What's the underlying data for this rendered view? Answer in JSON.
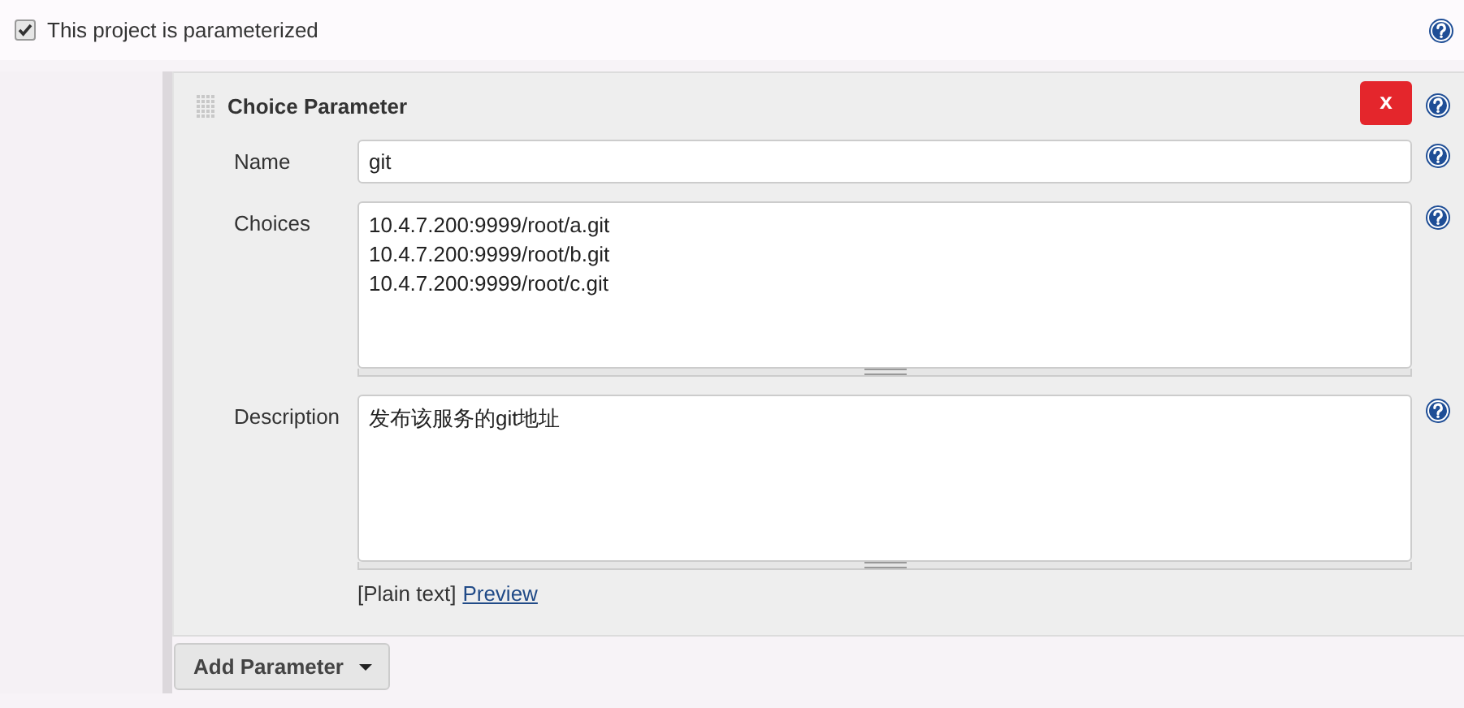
{
  "parameterized": {
    "label": "This project is parameterized",
    "checked": true
  },
  "parameter": {
    "title": "Choice Parameter",
    "delete_label": "x",
    "name": {
      "label": "Name",
      "value": "git"
    },
    "choices": {
      "label": "Choices",
      "lines": [
        "10.4.7.200:9999/root/a.git",
        "10.4.7.200:9999/root/b.git",
        "10.4.7.200:9999/root/c.git"
      ]
    },
    "description": {
      "label": "Description",
      "value": "发布该服务的git地址"
    },
    "format": {
      "label": "[Plain text]",
      "link": "Preview"
    }
  },
  "add_button": {
    "label": "Add Parameter"
  }
}
